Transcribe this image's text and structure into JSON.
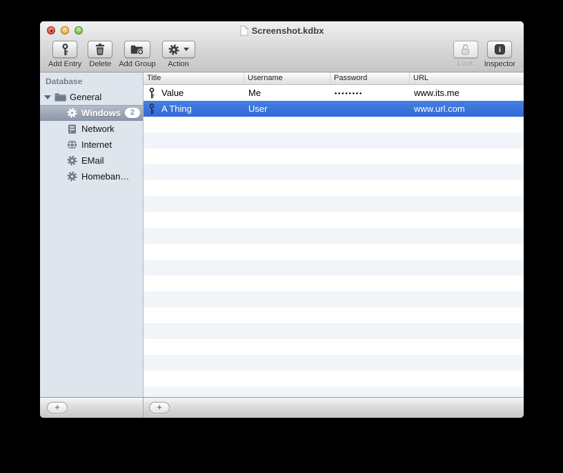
{
  "window": {
    "title": "Screenshot.kdbx"
  },
  "toolbar": {
    "items": [
      {
        "label": "Add Entry",
        "icon": "key-icon",
        "disabled": false
      },
      {
        "label": "Delete",
        "icon": "trash-icon",
        "disabled": false
      },
      {
        "label": "Add Group",
        "icon": "folder-plus-icon",
        "disabled": false
      },
      {
        "label": "Action",
        "icon": "gear-icon",
        "has_dropdown": true,
        "disabled": false
      }
    ],
    "right_items": [
      {
        "label": "Lock",
        "icon": "padlock-open-icon",
        "disabled": true
      },
      {
        "label": "Inspector",
        "icon": "inspector-icon",
        "disabled": false
      }
    ]
  },
  "sidebar": {
    "header": "Database",
    "root": {
      "label": "General",
      "icon": "folder-icon",
      "expanded": true
    },
    "items": [
      {
        "label": "Windows",
        "icon": "gear-icon",
        "badge": "2",
        "selected": true
      },
      {
        "label": "Network",
        "icon": "server-icon",
        "selected": false
      },
      {
        "label": "Internet",
        "icon": "globe-icon",
        "selected": false
      },
      {
        "label": "EMail",
        "icon": "gear-icon",
        "selected": false
      },
      {
        "label": "Homeban…",
        "icon": "gear-icon",
        "selected": false
      }
    ],
    "add_button_label": "+"
  },
  "table": {
    "columns": [
      {
        "label": "Title"
      },
      {
        "label": "Username"
      },
      {
        "label": "Password"
      },
      {
        "label": "URL"
      }
    ],
    "rows": [
      {
        "icon": "key-icon",
        "title": "Value",
        "username": "Me",
        "password": "••••••••",
        "url": "www.its.me",
        "selected": false
      },
      {
        "icon": "key-icon",
        "title": "A Thing",
        "username": "User",
        "password": "",
        "url": "www.url.com",
        "selected": true
      }
    ],
    "add_button_label": "+"
  },
  "colors": {
    "selection_blue": "#3b76dc",
    "stripe_blue": "#f1f5fa",
    "sidebar_bg": "#dfe5ec",
    "sidebar_selection_top": "#b2bbc7",
    "sidebar_selection_bottom": "#8c97a9",
    "chrome_top": "#f0f0f0",
    "chrome_bottom": "#c5c5c5",
    "traffic_red": "#d8544a",
    "traffic_yellow": "#f3b54a",
    "traffic_green": "#82c653"
  }
}
